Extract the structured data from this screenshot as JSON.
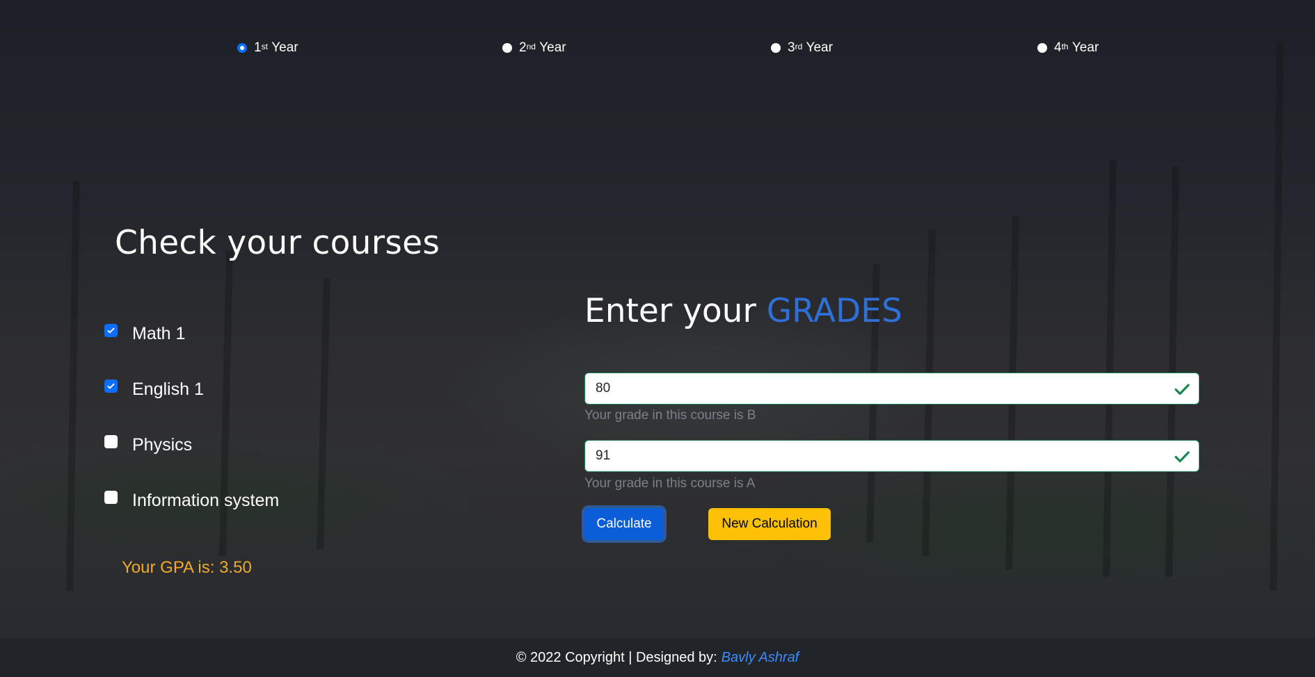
{
  "years": [
    {
      "num": "1",
      "sup": "st",
      "label": "Year",
      "selected": true
    },
    {
      "num": "2",
      "sup": "nd",
      "label": "Year",
      "selected": false
    },
    {
      "num": "3",
      "sup": "rd",
      "label": "Year",
      "selected": false
    },
    {
      "num": "4",
      "sup": "th",
      "label": "Year",
      "selected": false
    }
  ],
  "courses_section": {
    "title": "Check your courses",
    "courses": [
      {
        "label": "Math 1",
        "checked": true
      },
      {
        "label": "English 1",
        "checked": true
      },
      {
        "label": "Physics",
        "checked": false
      },
      {
        "label": "Information system",
        "checked": false
      }
    ],
    "gpa_text": "Your GPA is: 3.50"
  },
  "grades_section": {
    "title_prefix": "Enter your",
    "title_accent": "GRADES",
    "inputs": [
      {
        "value": "80",
        "hint": "Your grade in this course is B",
        "valid": true
      },
      {
        "value": "91",
        "hint": "Your grade in this course is A",
        "valid": true
      }
    ],
    "calculate_label": "Calculate",
    "new_calculation_label": "New Calculation"
  },
  "footer": {
    "text": "© 2022 Copyright | Designed by:",
    "author": "Bavly Ashraf"
  },
  "colors": {
    "accent": "#0d6efd",
    "valid": "#198754",
    "gpa": "#f0a92a",
    "warning_button": "#ffc107"
  }
}
